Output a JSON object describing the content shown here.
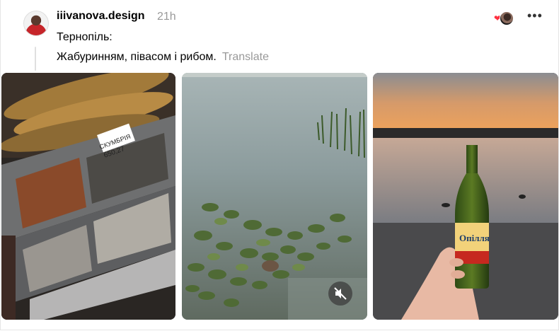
{
  "post": {
    "username": "iiivanova.design",
    "time": "21h",
    "text_line1": "Тернопіль:",
    "text_line2": "Жабуринням, півасом і рибом.",
    "translate_label": "Translate"
  },
  "icons": {
    "reaction": "heart-icon",
    "more": "more-icon",
    "mute": "muted-speaker-icon"
  },
  "media": [
    {
      "kind": "photo",
      "subject": "smoked-fish-display",
      "price_tag": "СКУМБРІЯ 650,27"
    },
    {
      "kind": "video",
      "subject": "lake-water-lilies"
    },
    {
      "kind": "photo",
      "subject": "sunset-beer-bottle",
      "bottle_label": "Опілля"
    }
  ],
  "colors": {
    "text": "#000000",
    "muted": "#999999",
    "heart": "#ff3040"
  }
}
